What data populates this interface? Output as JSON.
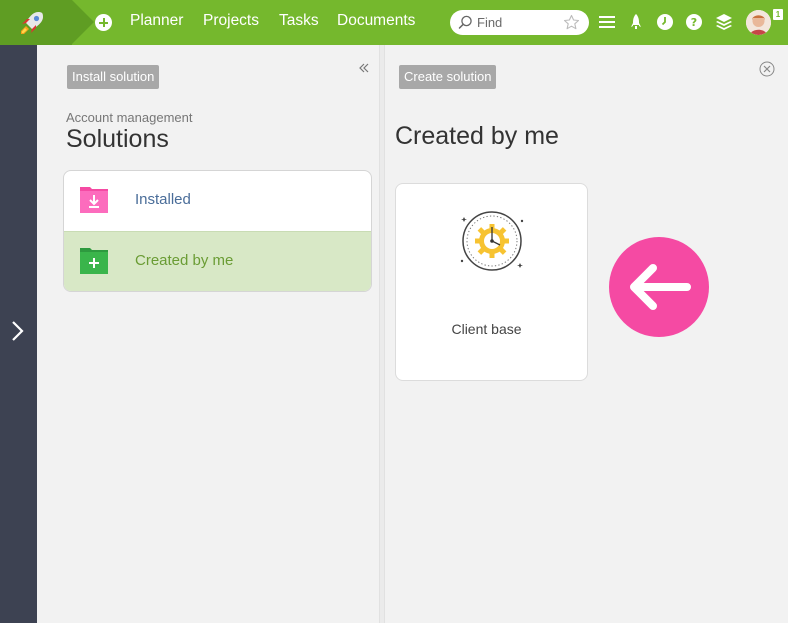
{
  "nav": {
    "items": [
      "Planner",
      "Projects",
      "Tasks",
      "Documents"
    ],
    "search_placeholder": "Find",
    "notification_count": "1"
  },
  "left_panel": {
    "install_button": "Install solution",
    "breadcrumb": "Account management",
    "title": "Solutions",
    "menu": [
      {
        "label": "Installed",
        "color": "#4a6d99",
        "icon_color": "#f54aa3"
      },
      {
        "label": "Created by me",
        "color": "#6a9c34",
        "icon_color": "#3aa84a"
      }
    ]
  },
  "right_panel": {
    "create_button": "Create solution",
    "title": "Created by me",
    "card_label": "Client base"
  },
  "colors": {
    "topbar": "#75b82d",
    "topbar_dark": "#5f9d23",
    "sidebar": "#3d4252",
    "accent_pink": "#f54aa3"
  }
}
